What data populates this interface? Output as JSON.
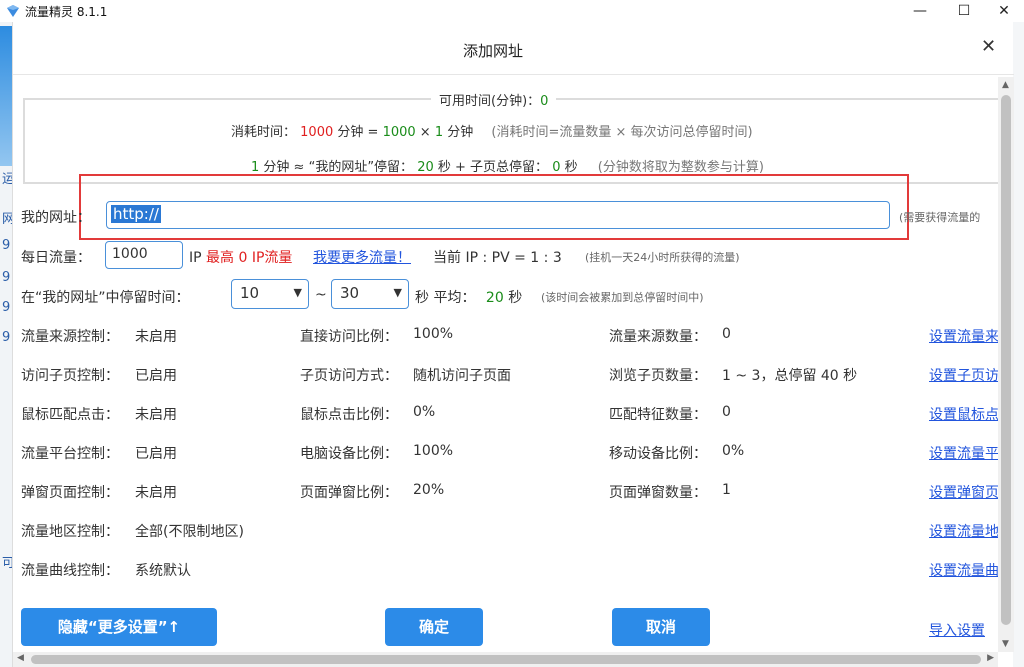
{
  "app": {
    "title": "流量精灵 8.1.1"
  },
  "window": {
    "minimize": "—",
    "maximize": "☐",
    "close": "✕"
  },
  "background_chars": [
    "运",
    "网",
    "9",
    "9",
    "9",
    "9",
    "可"
  ],
  "dialog": {
    "title": "添加网址",
    "close": "✕",
    "info": {
      "legend_label": "可用时间(分钟)：",
      "legend_value": "0",
      "line1": {
        "label": "消耗时间：",
        "value": "1000",
        "unit": "分钟 =",
        "count": "1000",
        "times": "×",
        "per": "1",
        "per_unit": "分钟",
        "note": "(消耗时间=流量数量 × 每次访问总停留时间)"
      },
      "line2": {
        "one": "1",
        "unit": "分钟 ≈ “我的网址”停留：",
        "stay": "20",
        "stay_unit": "秒 + 子页总停留：",
        "sub": "0",
        "sub_unit": "秒",
        "note": "(分钟数将取为整数参与计算)"
      }
    },
    "url_row": {
      "label": "我的网址：",
      "value": "http://",
      "hint": "(需要获得流量的"
    },
    "daily_row": {
      "label": "每日流量：",
      "value": "1000",
      "ip": "IP",
      "max_label": "最高",
      "max_value": "0 IP流量",
      "more_link": "我要更多流量！",
      "current": "当前 IP : PV = 1 : 3",
      "hint": "(挂机一天24小时所获得的流量)"
    },
    "stay_row": {
      "label": "在“我的网址”中停留时间：",
      "min": "10",
      "tilde": "~",
      "max": "30",
      "avg_label": "秒  平均：",
      "avg_value": "20",
      "avg_unit": "秒",
      "hint": "(该时间会被累加到总停留时间中)"
    },
    "settings": [
      {
        "label": "流量来源控制：",
        "value": "未启用",
        "mid_label": "直接访问比例：",
        "mid_value": "100%",
        "right_label": "流量来源数量：",
        "right_value": "0",
        "link": "设置流量来"
      },
      {
        "label": "访问子页控制：",
        "value": "已启用",
        "mid_label": "子页访问方式：",
        "mid_value": "随机访问子页面",
        "right_label": "浏览子页数量：",
        "right_value": "1 ~ 3，总停留 40 秒",
        "link": "设置子页访"
      },
      {
        "label": "鼠标匹配点击：",
        "value": "未启用",
        "mid_label": "鼠标点击比例：",
        "mid_value": "0%",
        "right_label": "匹配特征数量：",
        "right_value": "0",
        "link": "设置鼠标点"
      },
      {
        "label": "流量平台控制：",
        "value": "已启用",
        "mid_label": "电脑设备比例：",
        "mid_value": "100%",
        "right_label": "移动设备比例：",
        "right_value": "0%",
        "link": "设置流量平"
      },
      {
        "label": "弹窗页面控制：",
        "value": "未启用",
        "mid_label": "页面弹窗比例：",
        "mid_value": "20%",
        "right_label": "页面弹窗数量：",
        "right_value": "1",
        "link": "设置弹窗页"
      },
      {
        "label": "流量地区控制：",
        "value": "全部(不限制地区)",
        "mid_label": "",
        "mid_value": "",
        "right_label": "",
        "right_value": "",
        "link": "设置流量地"
      },
      {
        "label": "流量曲线控制：",
        "value": "系统默认",
        "mid_label": "",
        "mid_value": "",
        "right_label": "",
        "right_value": "",
        "link": "设置流量曲"
      }
    ],
    "buttons": {
      "hide_more": "隐藏“更多设置”↑",
      "confirm": "确定",
      "cancel": "取消",
      "import": "导入设置"
    }
  },
  "colors": {
    "accent": "#2c8be8",
    "enabled": "#1a8c1a",
    "disabled": "#999999",
    "alert": "#e02020",
    "highlight_box": "#e23a3a",
    "link": "#2255dd"
  }
}
